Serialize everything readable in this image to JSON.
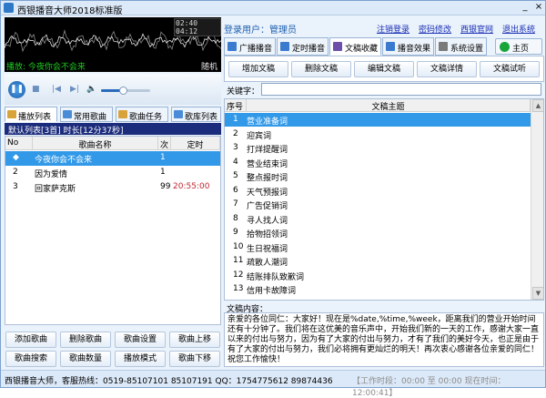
{
  "window": {
    "title": "西银播音大师2018标准版",
    "min": "_",
    "close": "×"
  },
  "player": {
    "time": "02:40 04:12",
    "now_playing": "播放: 今夜你会不会来",
    "mode": "随机",
    "volume_fraction": 0.45
  },
  "left_tabs": [
    "播放列表",
    "常用歌曲",
    "歌曲任务",
    "歌库列表"
  ],
  "playlist_header": "默认列表[3首] 时长[12分37秒]",
  "song_table": {
    "headers": [
      "No",
      "歌曲名称",
      "次",
      "定时"
    ],
    "rows": [
      {
        "no": "◆",
        "name": "今夜你会不会来",
        "count": "1",
        "time": ""
      },
      {
        "no": "2",
        "name": "因为爱情",
        "count": "1",
        "time": ""
      },
      {
        "no": "3",
        "name": "回家萨克斯",
        "count": "99",
        "time": "20:55:00"
      }
    ]
  },
  "left_buttons": [
    "添加歌曲",
    "删除歌曲",
    "歌曲设置",
    "歌曲上移",
    "歌曲搜索",
    "歌曲数量",
    "播放模式",
    "歌曲下移"
  ],
  "topbar": {
    "login": "登录用户：管理员",
    "links": [
      "注销登录",
      "密码修改",
      "西银官网",
      "退出系统"
    ]
  },
  "right_tabs": [
    "广播播音",
    "定时播音",
    "文稿收藏",
    "播音效果",
    "系统设置"
  ],
  "home": "主页",
  "ops": [
    "增加文稿",
    "删除文稿",
    "编辑文稿",
    "文稿详情",
    "文稿试听"
  ],
  "keyword_label": "关键字：",
  "draft_table": {
    "headers": [
      "序号",
      "文稿主题"
    ],
    "rows": [
      "营业准备词",
      "迎宾词",
      "打烊提醒词",
      "营业结束词",
      "整点报时词",
      "天气预报词",
      "广告促销词",
      "寻人找人词",
      "拾物招领词",
      "生日祝福词",
      "疏散人潮词",
      "结账排队致歉词",
      "信用卡故障词"
    ]
  },
  "content_label": "文稿内容：",
  "content_text": "亲爱的各位同仁：大家好！现在是%date,%time,%week，距离我们的营业开始时间还有十分钟了。我们将在这优美的音乐声中，开始我们新的一天的工作，感谢大家一直以来的付出与努力，因为有了大家的付出与努力，才有了我们的美好今天，也正是由于有了大家的付出与努力，我们必将拥有更灿烂的明天！再次衷心感谢各位亲爱的同仁！祝您工作愉快！",
  "status": {
    "contact": "西银播音大师，客服热线：0519-85107101 85107191 QQ：1754775612 89874436",
    "work": "【工作时段：00:00 至 00:00 现在时间：12:00:41】"
  }
}
